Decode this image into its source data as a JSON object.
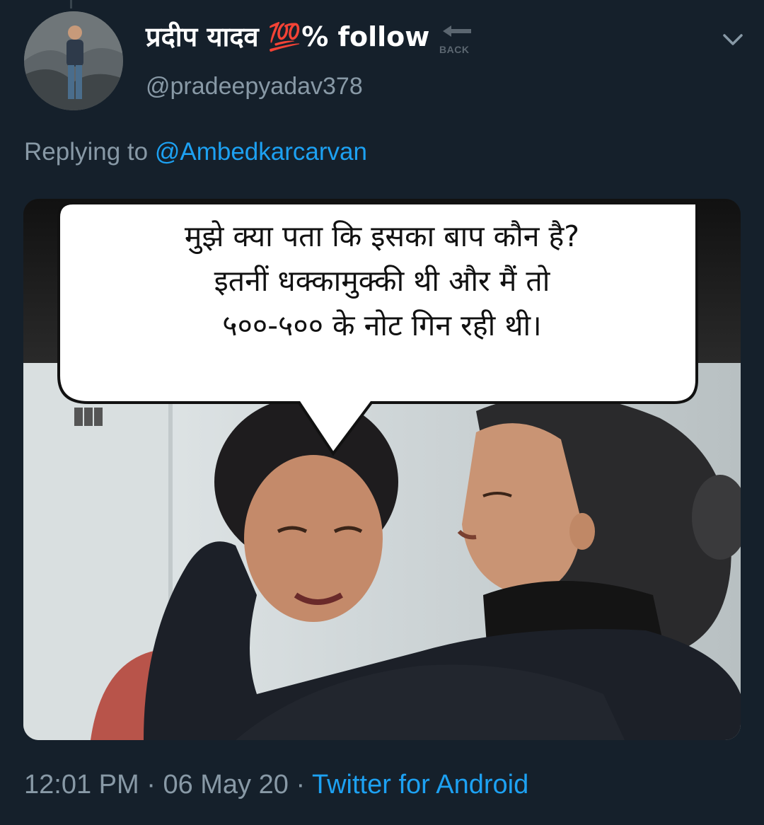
{
  "tweet": {
    "display_name": "प्रदीप यादव 💯% follow",
    "back_label": "BACK",
    "handle": "@pradeepyadav378",
    "replying_prefix": "Replying to",
    "replying_to": "@Ambedkarcarvan",
    "image_caption": {
      "line1": "मुझे क्या पता कि इसका बाप कौन है?",
      "line2": "इतनीं धक्कामुक्की थी और मैं तो",
      "line3": "५००-५०० के नोट गिन रही थी।"
    },
    "time": "12:01 PM",
    "date": "06 May 20",
    "separator": "·",
    "source": "Twitter for Android"
  },
  "icons": {
    "menu": "chevron-down-icon",
    "back": "back-arrow-icon"
  },
  "colors": {
    "background": "#15202b",
    "secondary_text": "#8899a6",
    "link": "#1da1f2"
  }
}
